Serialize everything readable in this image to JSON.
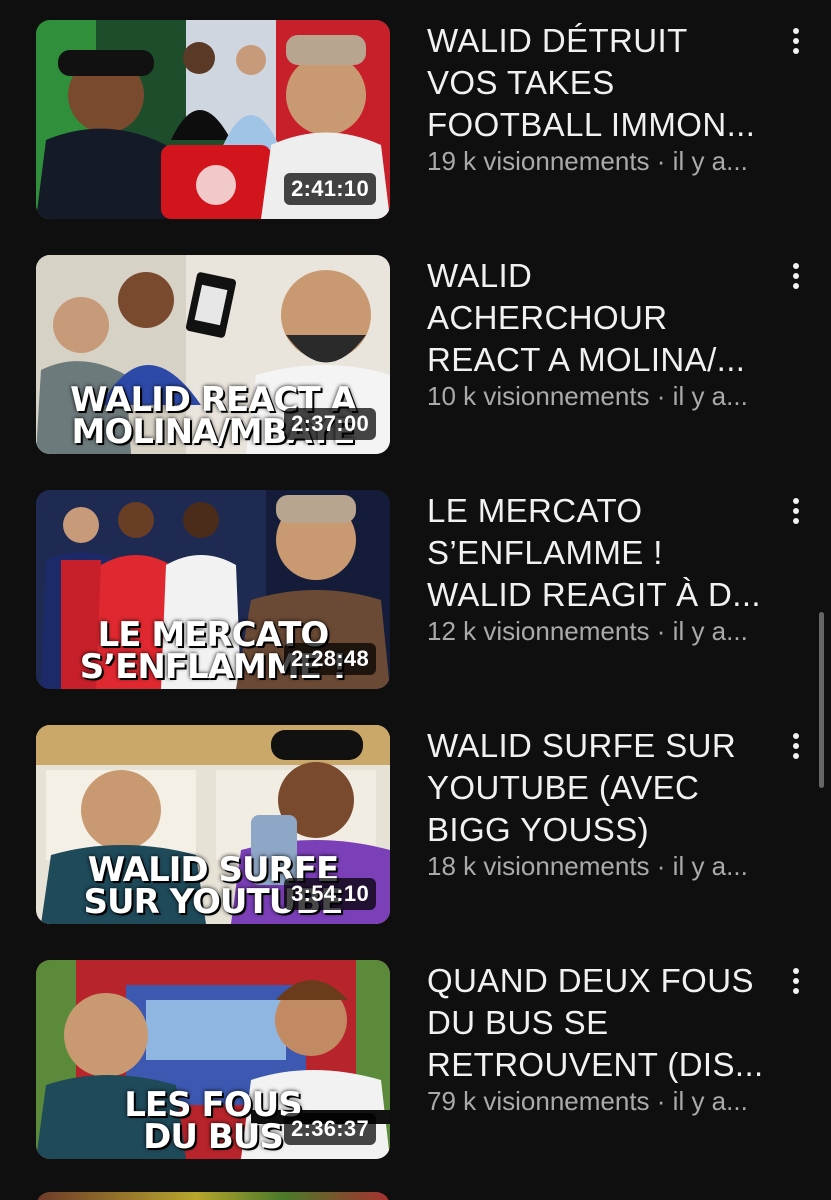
{
  "videos": [
    {
      "title_lines": [
        "WALID DÉTRUIT",
        "VOS TAKES",
        "FOOTBALL IMMON..."
      ],
      "views": "19 k visionnements · il y a...",
      "duration": "2:41:10",
      "overlay": ""
    },
    {
      "title_lines": [
        "WALID",
        "ACHERCHOUR",
        "REACT A MOLINA/..."
      ],
      "views": "10 k visionnements · il y a...",
      "duration": "2:37:00",
      "overlay_line1": "WALID REACT A",
      "overlay_line2": "MOLINA/MBAYE"
    },
    {
      "title_lines": [
        "LE MERCATO",
        "S’ENFLAMME !",
        "WALID REAGIT À D..."
      ],
      "views": "12 k visionnements · il y a...",
      "duration": "2:28:48",
      "overlay_line1": "LE MERCATO",
      "overlay_line2": "S’ENFLAMME !"
    },
    {
      "title_lines": [
        "WALID SURFE SUR",
        "YOUTUBE (AVEC",
        "BIGG YOUSS)"
      ],
      "views": "18 k visionnements · il y a...",
      "duration": "3:54:10",
      "overlay_line1": "WALID SURFE",
      "overlay_line2": "SUR YOUTUBE"
    },
    {
      "title_lines": [
        "QUAND DEUX FOUS",
        "DU BUS SE",
        "RETROUVENT (DIS..."
      ],
      "views": "79 k visionnements · il y a...",
      "duration": "2:36:37",
      "overlay_line1": "LES FOUS",
      "overlay_line2": "DU BUS"
    }
  ],
  "icons": {
    "more": "more-vert-icon"
  },
  "colors": {
    "background": "#0f0f0f",
    "title": "#f1f1f1",
    "meta": "#aaaaaa"
  }
}
